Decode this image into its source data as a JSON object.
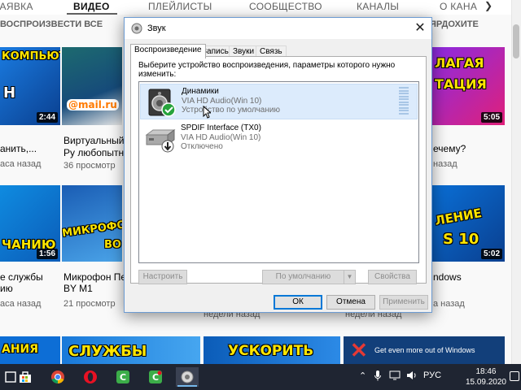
{
  "youtube": {
    "tabs": [
      "ЗАЯВКА",
      "ВИДЕО",
      "ПЛЕЙЛИСТЫ",
      "СООБЩЕСТВО",
      "КАНАЛЫ",
      "О КАНА"
    ],
    "active_tab": "ВИДЕО",
    "section_left": "ВОСПРОИЗВЕСТИ ВСЕ",
    "section_right": "ЯРДОХИТЕ",
    "row1": {
      "videos": [
        {
          "thumb_text": "КОМПЬЮТЕР",
          "thumb_text2": "Н",
          "duration": "2:44",
          "title": "анить,...",
          "meta": "аса назад"
        },
        {
          "thumb_text": "@mail.ru",
          "title": "Виртуальный",
          "title2": "Ру любопытны",
          "meta": "36 просмотр"
        },
        {
          "thumb_text": "ЛАГАЯ",
          "thumb_text2": "ТАЦИЯ",
          "duration": "5:05",
          "title": "ечему?",
          "meta": "назад"
        }
      ]
    },
    "row2": {
      "videos": [
        {
          "thumb_text": "ЧАНИЮ",
          "duration": "1:56",
          "title": "е службы",
          "title2": "ию",
          "meta": "аса назад"
        },
        {
          "thumb_text": "МИКРОФОН",
          "thumb_text2": "ВО",
          "title": "Микрофон Пе",
          "title2": "BY M1",
          "meta": "21 просмотр"
        },
        {
          "thumb_text": "ЛЕНИЕ",
          "thumb_text2": "S 10",
          "duration": "5:02",
          "title": "ndows",
          "meta": "а назад"
        }
      ]
    },
    "row2_under_dialog": [
      "недели назад",
      "недели назад"
    ],
    "row3": [
      "АНИЯ",
      "СЛУЖБЫ",
      "УСКОРИТЬ",
      "Get even more out of Windows"
    ]
  },
  "dialog": {
    "title": "Звук",
    "tabs": [
      "Воспроизведение",
      "Запись",
      "Звуки",
      "Связь"
    ],
    "active_tab": "Воспроизведение",
    "instruction": "Выберите устройство воспроизведения, параметры которого нужно изменить:",
    "devices": [
      {
        "name": "Динамики",
        "driver": "VIA HD Audio(Win 10)",
        "status": "Устройство по умолчанию",
        "selected": true,
        "icon": "speaker-icon",
        "badge": "default-check-icon"
      },
      {
        "name": "SPDIF Interface (TX0)",
        "driver": "VIA HD Audio(Win 10)",
        "status": "Отключено",
        "selected": false,
        "icon": "spdif-device-icon",
        "badge": "disabled-arrow-icon"
      }
    ],
    "buttons": {
      "configure": "Настроить",
      "set_default": "По умолчанию",
      "properties": "Свойства",
      "ok": "ОК",
      "cancel": "Отмена",
      "apply": "Применить"
    }
  },
  "taskbar": {
    "apps": [
      "windows-search-icon",
      "store-icon",
      "chrome-icon",
      "opera-icon",
      "camtasia-icon",
      "camtasia-recorder-icon",
      "sound-app-icon"
    ],
    "language": "РУС",
    "time": "18:46",
    "date": "15.09.2020"
  },
  "colors": {
    "dialog_border": "#6c9bd2",
    "selection": "#dcebfc",
    "taskbar": "#1f2532",
    "accent": "#0078d7"
  }
}
